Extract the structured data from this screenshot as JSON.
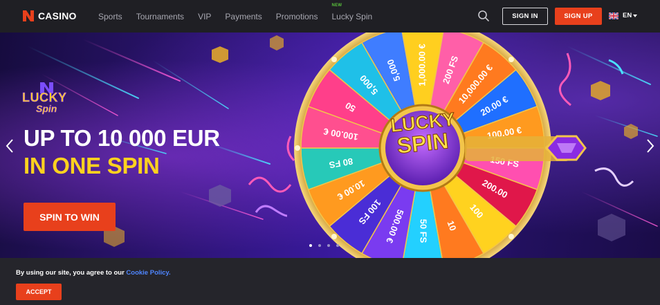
{
  "header": {
    "logo_text": "CASINO",
    "nav": [
      {
        "label": "Sports"
      },
      {
        "label": "Tournaments"
      },
      {
        "label": "VIP"
      },
      {
        "label": "Payments"
      },
      {
        "label": "Promotions"
      },
      {
        "label": "Lucky Spin",
        "badge": "NEW"
      }
    ],
    "sign_in": "SIGN IN",
    "sign_up": "SIGN UP",
    "language": "EN",
    "colors": {
      "accent": "#e8401c",
      "badge": "#59c23c"
    }
  },
  "hero": {
    "logo_word1": "LUCKY",
    "logo_word2": "Spin",
    "headline_line1": "UP TO 10 000 EUR",
    "headline_line2": "IN ONE SPIN",
    "cta": "SPIN TO WIN",
    "wheel_center_line1": "LUCKY",
    "wheel_center_line2": "SPIN",
    "wheel_segments": [
      "5,000",
      "5,000",
      "1,000.00 €",
      "200 FS",
      "10,000.00 €",
      "20.00 €",
      "100.00 €",
      "150 FS",
      "200.00",
      "100",
      "10",
      "50 FS",
      "500.00 €",
      "100 FS",
      "10.00 €",
      "80 FS",
      "100.00 €",
      "50"
    ],
    "carousel": {
      "slides": 4,
      "active_index": 0
    }
  },
  "cookie": {
    "text": "By using our site, you agree to our ",
    "link": "Cookie Policy.",
    "accept": "ACCEPT"
  }
}
